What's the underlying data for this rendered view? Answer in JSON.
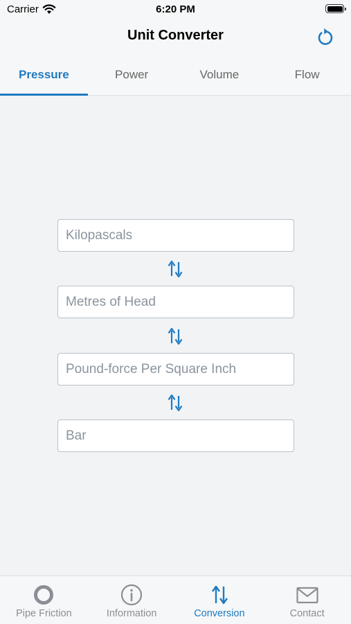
{
  "status_bar": {
    "carrier": "Carrier",
    "time": "6:20 PM"
  },
  "header": {
    "title": "Unit Converter",
    "refresh_icon": "refresh-icon"
  },
  "tabs": [
    {
      "label": "Pressure",
      "active": true
    },
    {
      "label": "Power",
      "active": false
    },
    {
      "label": "Volume",
      "active": false
    },
    {
      "label": "Flow",
      "active": false
    }
  ],
  "converter": {
    "fields": [
      {
        "placeholder": "Kilopascals",
        "value": ""
      },
      {
        "placeholder": "Metres of Head",
        "value": ""
      },
      {
        "placeholder": "Pound-force Per Square Inch",
        "value": ""
      },
      {
        "placeholder": "Bar",
        "value": ""
      }
    ],
    "swap_icon": "swap-arrows-icon"
  },
  "tab_bar": {
    "items": [
      {
        "label": "Pipe Friction",
        "icon": "ring-icon",
        "active": false
      },
      {
        "label": "Information",
        "icon": "info-icon",
        "active": false
      },
      {
        "label": "Conversion",
        "icon": "swap-arrows-icon",
        "active": true
      },
      {
        "label": "Contact",
        "icon": "envelope-icon",
        "active": false
      }
    ]
  },
  "colors": {
    "accent": "#1f7ac1",
    "inactive": "#8a8f95",
    "background": "#f1f3f5"
  }
}
